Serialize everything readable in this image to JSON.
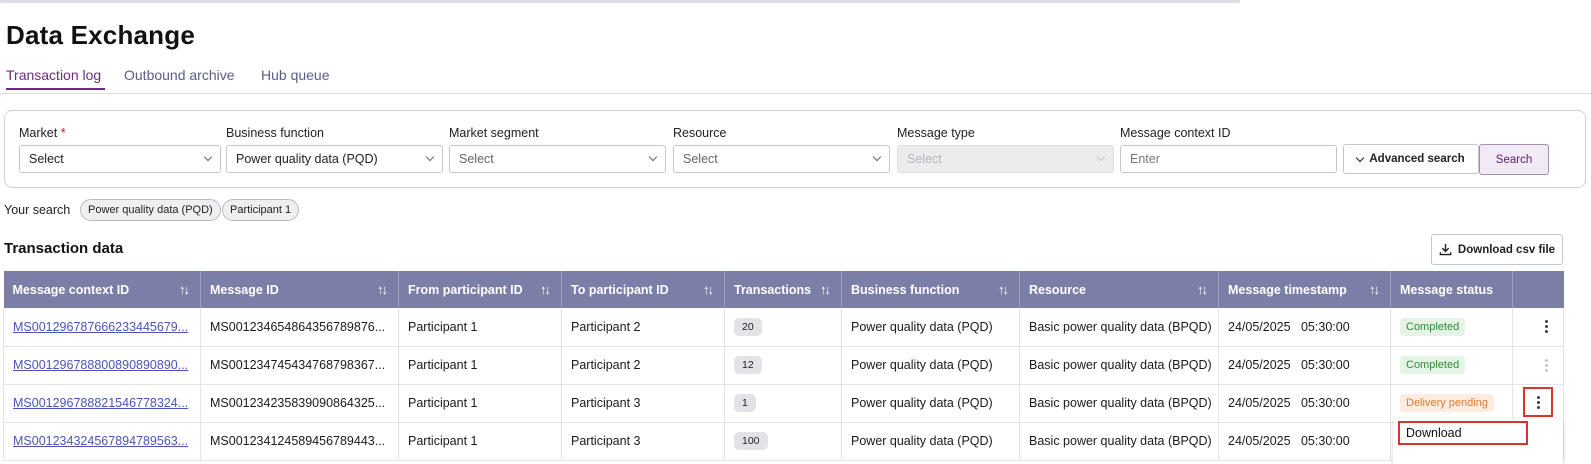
{
  "page": {
    "title": "Data Exchange"
  },
  "tabs": [
    {
      "label": "Transaction log",
      "active": true
    },
    {
      "label": "Outbound archive",
      "active": false
    },
    {
      "label": "Hub queue",
      "active": false
    }
  ],
  "filters": {
    "market": {
      "label": "Market",
      "required_mark": "*",
      "value": "Select"
    },
    "business_function": {
      "label": "Business function",
      "value": "Power quality data (PQD)"
    },
    "market_segment": {
      "label": "Market segment",
      "value": "Select"
    },
    "resource": {
      "label": "Resource",
      "value": "Select"
    },
    "message_type": {
      "label": "Message type",
      "value": "Select",
      "disabled": true
    },
    "message_context_id": {
      "label": "Message context ID",
      "placeholder": "Enter"
    },
    "advanced_search_label": "Advanced search",
    "search_label": "Search"
  },
  "your_search": {
    "label": "Your search",
    "chips": [
      "Power quality data (PQD)",
      "Participant 1"
    ]
  },
  "transaction_data": {
    "title": "Transaction data",
    "download_csv_label": "Download csv file",
    "columns": [
      "Message context ID",
      "Message ID",
      "From participant ID",
      "To participant ID",
      "Transactions",
      "Business function",
      "Resource",
      "Message timestamp",
      "Message status"
    ],
    "rows": [
      {
        "context_id": "MS001296787666233445679...",
        "message_id": "MS001234654864356789876...",
        "from": "Participant 1",
        "to": "Participant 2",
        "transactions": "20",
        "business_function": "Power quality data (PQD)",
        "resource": "Basic power quality data (BPQD)",
        "date": "24/05/2025",
        "time": "05:30:00",
        "status": "Completed"
      },
      {
        "context_id": "MS001296788800890890890...",
        "message_id": "MS001234745434768798367...",
        "from": "Participant 1",
        "to": "Participant 2",
        "transactions": "12",
        "business_function": "Power quality data (PQD)",
        "resource": "Basic power quality data (BPQD)",
        "date": "24/05/2025",
        "time": "05:30:00",
        "status": "Completed"
      },
      {
        "context_id": "MS001296788821546778324...",
        "message_id": "MS001234235839090864325...",
        "from": "Participant 1",
        "to": "Participant 3",
        "transactions": "1",
        "business_function": "Power quality data (PQD)",
        "resource": "Basic power quality data (BPQD)",
        "date": "24/05/2025",
        "time": "05:30:00",
        "status": "Delivery pending"
      },
      {
        "context_id": "MS001234324567894789563...",
        "message_id": "MS001234124589456789443...",
        "from": "Participant 1",
        "to": "Participant 3",
        "transactions": "100",
        "business_function": "Power quality data (PQD)",
        "resource": "Basic power quality data (BPQD)",
        "date": "24/05/2025",
        "time": "05:30:00",
        "status": ""
      }
    ]
  },
  "row_menu": {
    "items": [
      "Download"
    ]
  },
  "icons": {
    "sort": "sort-arrows-icon",
    "kebab": "kebab-menu-icon",
    "download": "download-icon",
    "chevron": "chevron-down-icon"
  },
  "colors": {
    "accent": "#6a2c7e",
    "table_header": "#7b7fa8",
    "completed": "#2f8a39",
    "pending": "#db7b34",
    "highlight": "#d9342b"
  }
}
